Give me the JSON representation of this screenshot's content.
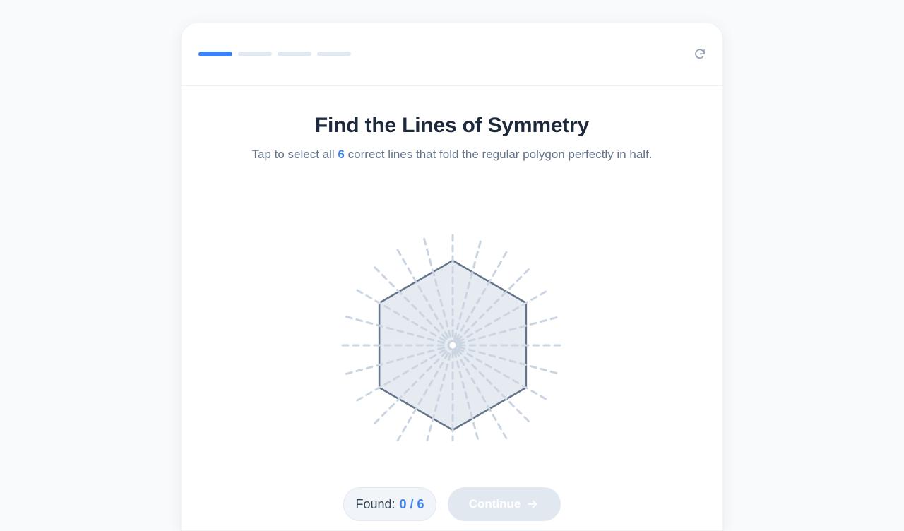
{
  "progress": {
    "total_steps": 4,
    "current_step": 1
  },
  "header": {
    "reset_icon": "refresh-icon"
  },
  "prompt": {
    "title": "Find the Lines of Symmetry",
    "subtitle_before": "Tap to select all",
    "subtitle_count": "6",
    "subtitle_after": "correct lines that fold the regular polygon perfectly in half."
  },
  "puzzle": {
    "shape": "regular hexagon",
    "sides": 6,
    "candidate_line_count": 24,
    "selected_count": 0,
    "colors": {
      "fill": "#e2e8f0",
      "stroke": "#64748b",
      "line": "#cbd5e1",
      "accent": "#3b82f6"
    }
  },
  "footer": {
    "found_label": "Found:",
    "found_value": "0 / 6",
    "continue_label": "Continue",
    "continue_icon": "arrow-right-icon"
  }
}
